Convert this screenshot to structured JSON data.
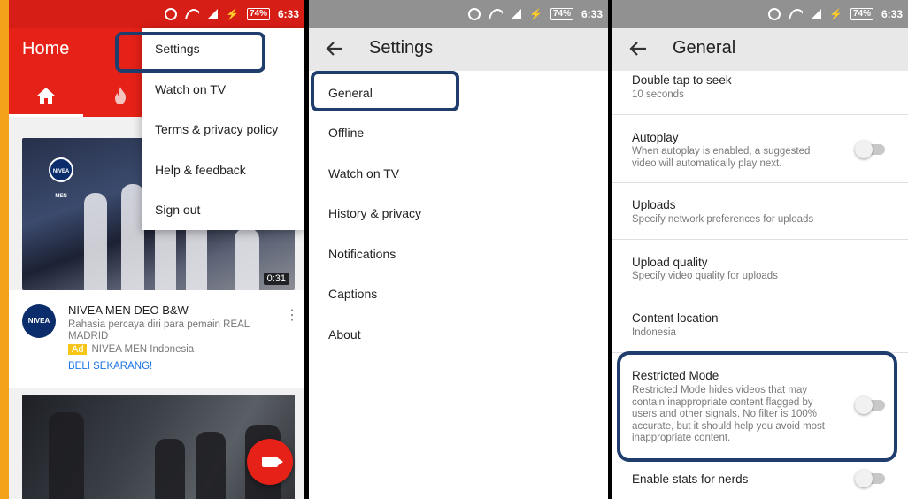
{
  "status_bar": {
    "time": "6:33",
    "battery": "74%"
  },
  "panel1": {
    "title": "Home",
    "tabs": [
      {
        "icon": "home-icon"
      },
      {
        "icon": "trending-flame-icon"
      }
    ],
    "menu": [
      "Settings",
      "Watch on TV",
      "Terms & privacy policy",
      "Help & feedback",
      "Sign out"
    ],
    "video": {
      "duration": "0:31",
      "logo_text": "NIVEA MEN",
      "title": "NIVEA MEN DEO B&W",
      "description": "Rahasia percaya diri para pemain REAL MADRID",
      "ad_badge": "Ad",
      "channel": "NIVEA MEN Indonesia",
      "cta": "BELI SEKARANG!"
    }
  },
  "panel2": {
    "title": "Settings",
    "items": [
      "General",
      "Offline",
      "Watch on TV",
      "History & privacy",
      "Notifications",
      "Captions",
      "About"
    ]
  },
  "panel3": {
    "title": "General",
    "items": [
      {
        "title": "Double tap to seek",
        "subtitle": "10 seconds",
        "toggle": false
      },
      {
        "title": "Autoplay",
        "subtitle": "When autoplay is enabled, a suggested video will automatically play next.",
        "toggle": true,
        "enabled": false
      },
      {
        "title": "Uploads",
        "subtitle": "Specify network preferences for uploads",
        "toggle": false
      },
      {
        "title": "Upload quality",
        "subtitle": "Specify video quality for uploads",
        "toggle": false
      },
      {
        "title": "Content location",
        "subtitle": "Indonesia",
        "toggle": false
      },
      {
        "title": "Restricted Mode",
        "subtitle": "Restricted Mode hides videos that may contain inappropriate content flagged by users and other signals. No filter is 100% accurate, but it should help you avoid most inappropriate content.",
        "toggle": true,
        "enabled": false
      },
      {
        "title": "Enable stats for nerds",
        "subtitle": "",
        "toggle": true,
        "enabled": false
      }
    ]
  },
  "colors": {
    "youtube_red": "#e62117",
    "highlight": "#1f3e6e",
    "frame_orange": "#f4a21a"
  }
}
